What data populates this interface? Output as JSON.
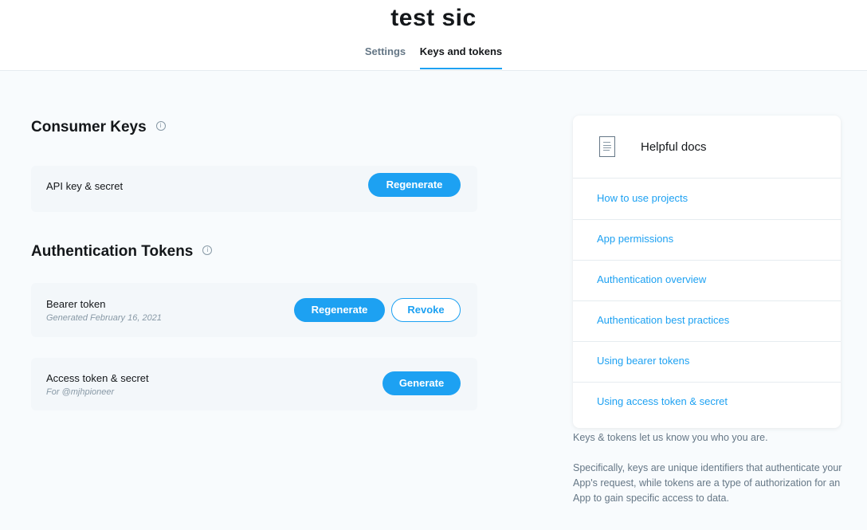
{
  "app": {
    "title": "test sic"
  },
  "tabs": [
    {
      "label": "Settings",
      "active": false
    },
    {
      "label": "Keys and tokens",
      "active": true
    }
  ],
  "consumer_keys": {
    "title": "Consumer Keys",
    "info_icon": "info-icon",
    "rows": [
      {
        "label": "API key & secret",
        "regenerate_label": "Regenerate"
      }
    ]
  },
  "auth_tokens": {
    "title": "Authentication Tokens",
    "info_icon": "info-icon",
    "bearer": {
      "label": "Bearer token",
      "sub": "Generated February 16, 2021",
      "regenerate_label": "Regenerate",
      "revoke_label": "Revoke"
    },
    "access": {
      "label": "Access token & secret",
      "sub": "For @mjhpioneer",
      "generate_label": "Generate"
    }
  },
  "docs": {
    "title": "Helpful docs",
    "icon": "document-icon",
    "links": [
      "How to use projects",
      "App permissions",
      "Authentication overview",
      "Authentication best practices",
      "Using bearer tokens",
      "Using access token & secret"
    ]
  },
  "sidebar_text": {
    "p1": "Keys & tokens let us know you who you are.",
    "p2": "Specifically, keys are unique identifiers that authenticate your App's request, while tokens are a type of authorization for an App to gain specific access to data."
  },
  "colors": {
    "accent": "#1da1f2",
    "text": "#14171a",
    "muted": "#657786",
    "background": "#f8fbfd"
  }
}
